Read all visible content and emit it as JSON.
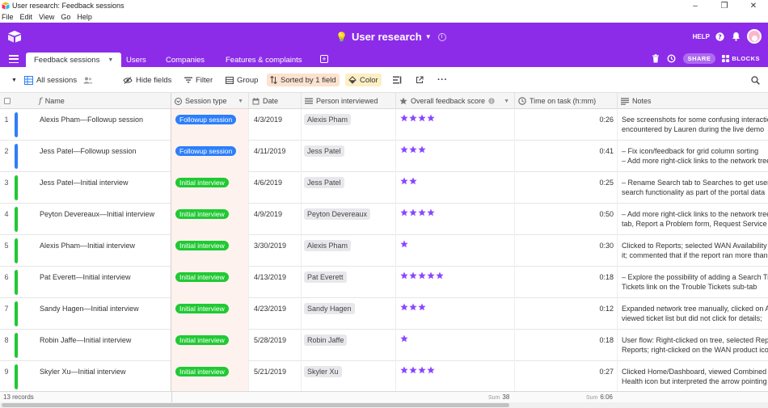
{
  "window": {
    "title": "User research: Feedback sessions",
    "controls": [
      "–",
      "❐",
      "✕"
    ]
  },
  "menu": [
    "File",
    "Edit",
    "View",
    "Go",
    "Help"
  ],
  "header": {
    "base_emoji": "💡",
    "base_title": "User research",
    "help_label": "HELP"
  },
  "tabs": [
    {
      "label": "Feedback sessions",
      "active": true
    },
    {
      "label": "Users"
    },
    {
      "label": "Companies"
    },
    {
      "label": "Features & complaints"
    }
  ],
  "tab_actions": {
    "share_label": "SHARE",
    "blocks_label": "BLOCKS"
  },
  "toolbar": {
    "view_name": "All sessions",
    "hide_fields": "Hide fields",
    "filter": "Filter",
    "group": "Group",
    "sorted": "Sorted by 1 field",
    "color": "Color"
  },
  "columns": {
    "name": "Name",
    "session_type": "Session type",
    "date": "Date",
    "person": "Person interviewed",
    "score": "Overall feedback score",
    "time": "Time on task (h:mm)",
    "notes": "Notes"
  },
  "colors": {
    "brand": "#8c2ce8",
    "followup": "#2d7ff9",
    "initial": "#20c933",
    "star": "#8b46ff"
  },
  "rows": [
    {
      "num": "1",
      "name": "Alexis Pham—Followup session",
      "type": "Followup session",
      "type_key": "followup",
      "date": "4/3/2019",
      "person": "Alexis Pham",
      "score": 4,
      "time": "0:26",
      "notes1": "See screenshots for some confusing interaction",
      "notes2": "encountered by Lauren during the live demo"
    },
    {
      "num": "2",
      "name": "Jess Patel—Followup session",
      "type": "Followup session",
      "type_key": "followup",
      "date": "4/11/2019",
      "person": "Jess Patel",
      "score": 3,
      "time": "0:41",
      "notes1": "– Fix icon/feedback for grid column sorting",
      "notes2": "– Add more right-click links to the network tree"
    },
    {
      "num": "3",
      "name": "Jess Patel—Initial interview",
      "type": "Initial interview",
      "type_key": "initial",
      "date": "4/6/2019",
      "person": "Jess Patel",
      "score": 2,
      "time": "0:25",
      "notes1": "– Rename Search tab to Searches to get users to",
      "notes2": "search functionality as part of the portal data"
    },
    {
      "num": "4",
      "name": "Peyton Devereaux—Initial interview",
      "type": "Initial interview",
      "type_key": "initial",
      "date": "4/9/2019",
      "person": "Peyton Devereaux",
      "score": 4,
      "time": "0:50",
      "notes1": "– Add more right-click links to the network tree",
      "notes2": "tab, Report a Problem form, Request Service"
    },
    {
      "num": "5",
      "name": "Alexis Pham—Initial interview",
      "type": "Initial interview",
      "type_key": "initial",
      "date": "3/30/2019",
      "person": "Alexis Pham",
      "score": 1,
      "time": "0:30",
      "notes1": "Clicked to Reports; selected WAN Availability",
      "notes2": "it; commented that if the report ran more than"
    },
    {
      "num": "6",
      "name": "Pat Everett—Initial interview",
      "type": "Initial interview",
      "type_key": "initial",
      "date": "4/13/2019",
      "person": "Pat Everett",
      "score": 5,
      "time": "0:18",
      "notes1": "– Explore the possibility of adding a Search Tr",
      "notes2": "Tickets link on the Trouble Tickets sub-tab"
    },
    {
      "num": "7",
      "name": "Sandy Hagen—Initial interview",
      "type": "Initial interview",
      "type_key": "initial",
      "date": "4/23/2019",
      "person": "Sandy Hagen",
      "score": 3,
      "time": "0:12",
      "notes1": "Expanded network tree manually, clicked on A",
      "notes2": "viewed ticket list but did not click for details;"
    },
    {
      "num": "8",
      "name": "Robin Jaffe—Initial interview",
      "type": "Initial interview",
      "type_key": "initial",
      "date": "5/28/2019",
      "person": "Robin Jaffe",
      "score": 1,
      "time": "0:18",
      "notes1": "User flow: Right-clicked on tree, selected Rep",
      "notes2": "Reports; right-clicked on the WAN product icon"
    },
    {
      "num": "9",
      "name": "Skyler Xu—Initial interview",
      "type": "Initial interview",
      "type_key": "initial",
      "date": "5/21/2019",
      "person": "Skyler Xu",
      "score": 4,
      "time": "0:27",
      "notes1": "Clicked Home/Dashboard, viewed Combined",
      "notes2": "Health icon but interpreted the arrow pointing"
    }
  ],
  "footer": {
    "records": "13 records",
    "sum_label": "Sum",
    "score_sum": "38",
    "time_sum": "6:06"
  }
}
